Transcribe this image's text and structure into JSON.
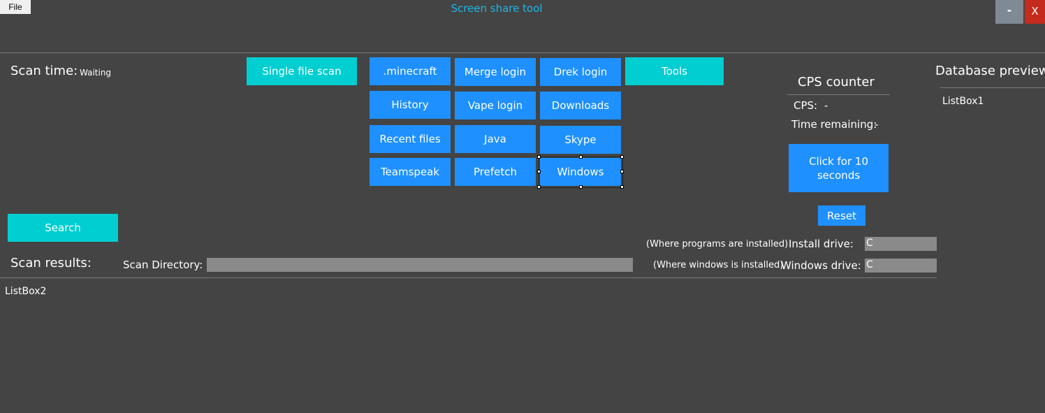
{
  "menu": {
    "file_label": "File"
  },
  "window": {
    "title": "Screen share tool",
    "minimize_label": "-",
    "close_label": "X"
  },
  "scan_time": {
    "label": "Scan time:",
    "value": "Waiting"
  },
  "buttons": {
    "single_file_scan": "Single file scan",
    "minecraft": ".minecraft",
    "merge_login": "Merge login",
    "drek_login": "Drek login",
    "tools": "Tools",
    "history": "History",
    "vape_login": "Vape login",
    "downloads": "Downloads",
    "recent_files": "Recent files",
    "java": "Java",
    "skype": "Skype",
    "teamspeak": "Teamspeak",
    "prefetch": "Prefetch",
    "windows": "Windows",
    "search": "Search"
  },
  "cps": {
    "title": "CPS counter",
    "cps_label": "CPS:",
    "cps_value": "-",
    "time_label": "Time remaining:",
    "time_value": "-",
    "click_button": "Click for 10 seconds",
    "reset_button": "Reset"
  },
  "database": {
    "title": "Database preview",
    "listbox": "ListBox1"
  },
  "drives": {
    "install_hint": "(Where programs are installed)",
    "install_label": "Install drive:",
    "install_value": "C",
    "windows_hint": "(Where windows is installed)",
    "windows_label": "Windows drive:",
    "windows_value": "C"
  },
  "results": {
    "label": "Scan results:",
    "scan_dir_label": "Scan Directory:",
    "scan_dir_value": "",
    "listbox": "ListBox2"
  },
  "colors": {
    "background": "#444444",
    "blue_button": "#1e90ff",
    "cyan_button": "#00ced1",
    "title": "#1fb6e8"
  }
}
